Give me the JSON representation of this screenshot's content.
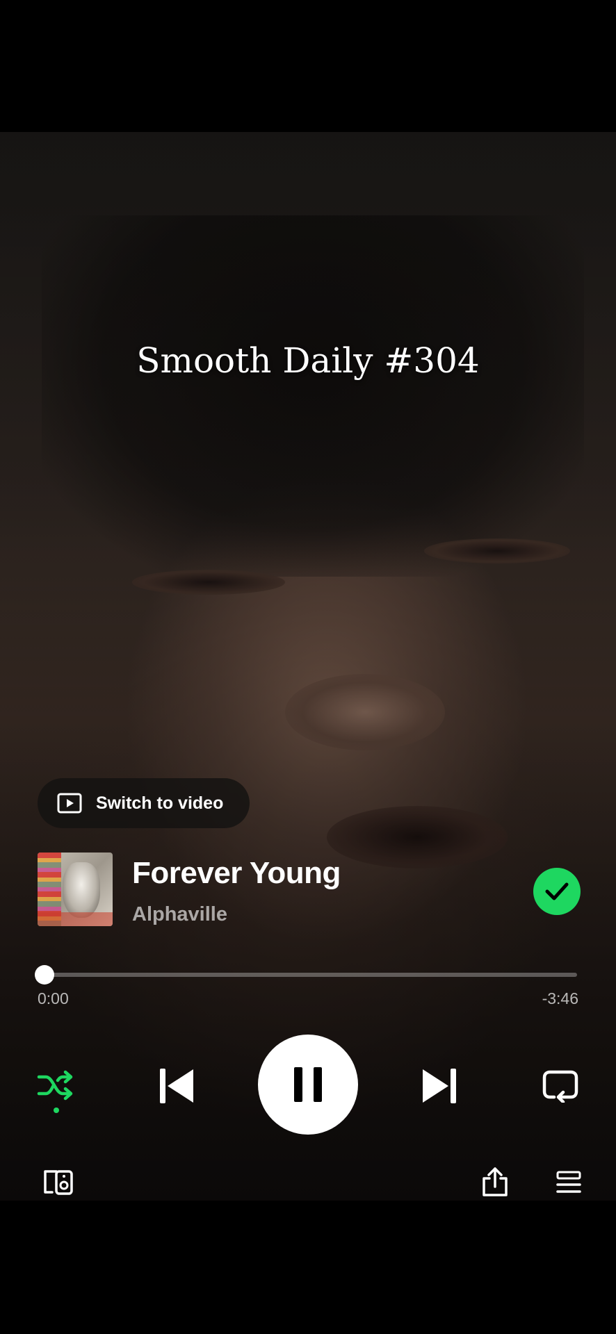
{
  "overlay": {
    "caption": "Smooth Daily #304"
  },
  "switch_video": {
    "label": "Switch to video",
    "icon": "video-play-icon"
  },
  "track": {
    "title": "Forever Young",
    "artist": "Alphaville",
    "album_art": "album-art-forever-young",
    "saved": true
  },
  "progress": {
    "elapsed": "0:00",
    "remaining": "-3:46",
    "fraction": 0.0
  },
  "controls": {
    "shuffle": {
      "icon": "shuffle-icon",
      "active": true
    },
    "previous": {
      "icon": "skip-previous-icon"
    },
    "play_pause": {
      "icon": "pause-icon",
      "state": "playing"
    },
    "next": {
      "icon": "skip-next-icon"
    },
    "repeat": {
      "icon": "repeat-icon",
      "active": false
    }
  },
  "footer": {
    "devices": {
      "icon": "connect-devices-icon"
    },
    "share": {
      "icon": "share-icon"
    },
    "queue": {
      "icon": "queue-icon"
    }
  },
  "colors": {
    "accent": "#1ed760",
    "background": "#000000",
    "text": "#ffffff"
  }
}
